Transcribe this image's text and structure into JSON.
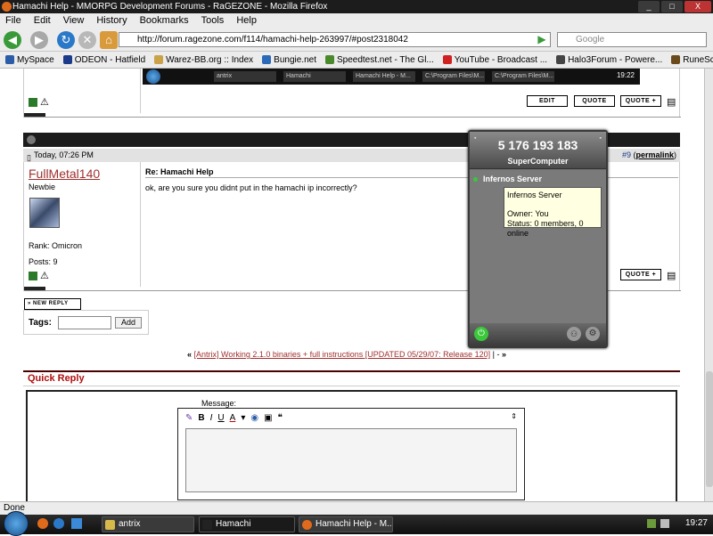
{
  "window": {
    "title": "Hamachi Help - MMORPG Development Forums - RaGEZONE - Mozilla Firefox",
    "controls": [
      "_",
      "□",
      "X"
    ]
  },
  "menu": [
    "File",
    "Edit",
    "View",
    "History",
    "Bookmarks",
    "Tools",
    "Help"
  ],
  "nav": {
    "url": "http://forum.ragezone.com/f114/hamachi-help-263997/#post2318042",
    "search_placeholder": "Google"
  },
  "bookmarks": [
    {
      "label": "MySpace",
      "color": "#2a5ca8"
    },
    {
      "label": "ODEON - Hatfield",
      "color": "#1a3a8a"
    },
    {
      "label": "Warez-BB.org :: Index",
      "color": "#c9a24a"
    },
    {
      "label": "Bungie.net",
      "color": "#2a6ab8"
    },
    {
      "label": "Speedtest.net - The Gl...",
      "color": "#4a8a2a"
    },
    {
      "label": "YouTube - Broadcast ...",
      "color": "#d02020"
    },
    {
      "label": "Halo3Forum - Powere...",
      "color": "#444444"
    },
    {
      "label": "RuneScape - the massi...",
      "color": "#6a4a1a"
    }
  ],
  "embedded_taskbar": {
    "buttons": [
      "antrix",
      "Hamachi",
      "Hamachi Help - M...",
      "C:\\Program Files\\M...",
      "C:\\Program Files\\M..."
    ],
    "clock": "19:22"
  },
  "post_buttons": {
    "edit": "EDIT",
    "quote": "QUOTE",
    "multiquote": "QUOTE +"
  },
  "post": {
    "timestamp": "Today, 07:26 PM",
    "number": "#9",
    "permalink": "permalink",
    "author": "FullMetal140",
    "user_title": "Newbie",
    "rank_label": "Rank:",
    "rank_value": "Omicron",
    "posts_label": "Posts:",
    "posts_value": "9",
    "subject": "Re: Hamachi Help",
    "body": "ok, are you sure you didnt put in the hamachi ip incorrectly?"
  },
  "new_reply_label": "NEW REPLY",
  "tags": {
    "label": "Tags:",
    "add_button": "Add"
  },
  "thread_nav": {
    "prev": "«",
    "link": "[Antrix] Working 2.1.0 binaries + full instructions [UPDATED 05/29/07: Release 120]",
    "sep": "|",
    "dash": "-",
    "next": "»"
  },
  "quick_reply": {
    "title": "Quick Reply",
    "message_label": "Message:",
    "toolbar": [
      "B",
      "I",
      "U",
      "A"
    ]
  },
  "hamachi": {
    "address": "5 176 193 183",
    "nickname": "SuperComputer",
    "network": "Infernos Server",
    "tooltip_title": "Infernos Server",
    "tooltip_owner": "Owner: You",
    "tooltip_status": "Status: 0 members, 0 online",
    "accent_color": "#3ac83a"
  },
  "status_text": "Done",
  "taskbar": {
    "buttons": [
      "antrix",
      "Hamachi",
      "Hamachi Help - M..."
    ],
    "clock": "19:27"
  },
  "colors": {
    "link": "#a03030",
    "quick_reply_title": "#b01010",
    "author": "#a03030"
  }
}
